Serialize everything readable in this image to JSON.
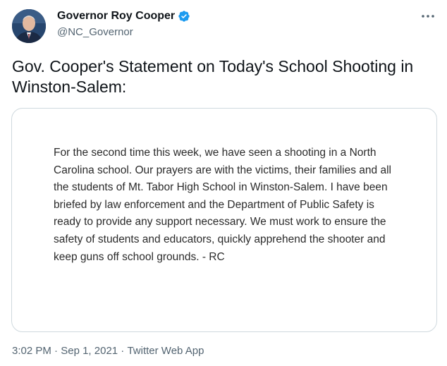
{
  "header": {
    "display_name": "Governor Roy Cooper",
    "handle": "@NC_Governor",
    "avatar_icon": "profile-photo",
    "verified_icon": "verified-badge-icon",
    "more_icon": "more-horizontal-icon"
  },
  "tweet": {
    "text": "Gov. Cooper's Statement on Today's School Shooting in Winston-Salem:"
  },
  "media": {
    "statement": "For the second time this week, we have seen a shooting in a North Carolina school. Our prayers are with the victims, their families and all the students of Mt. Tabor High School in Winston-Salem. I have been briefed by law enforcement and the Department of Public Safety is ready to provide any support necessary. We must work to ensure the safety of students and educators, quickly apprehend the shooter and keep guns off school grounds. - RC"
  },
  "meta": {
    "time": "3:02 PM",
    "separator": " · ",
    "date": "Sep 1, 2021",
    "source": "Twitter Web App"
  },
  "colors": {
    "verified": "#1d9bf0",
    "muted_text": "#536471",
    "border": "#cfd9de"
  }
}
